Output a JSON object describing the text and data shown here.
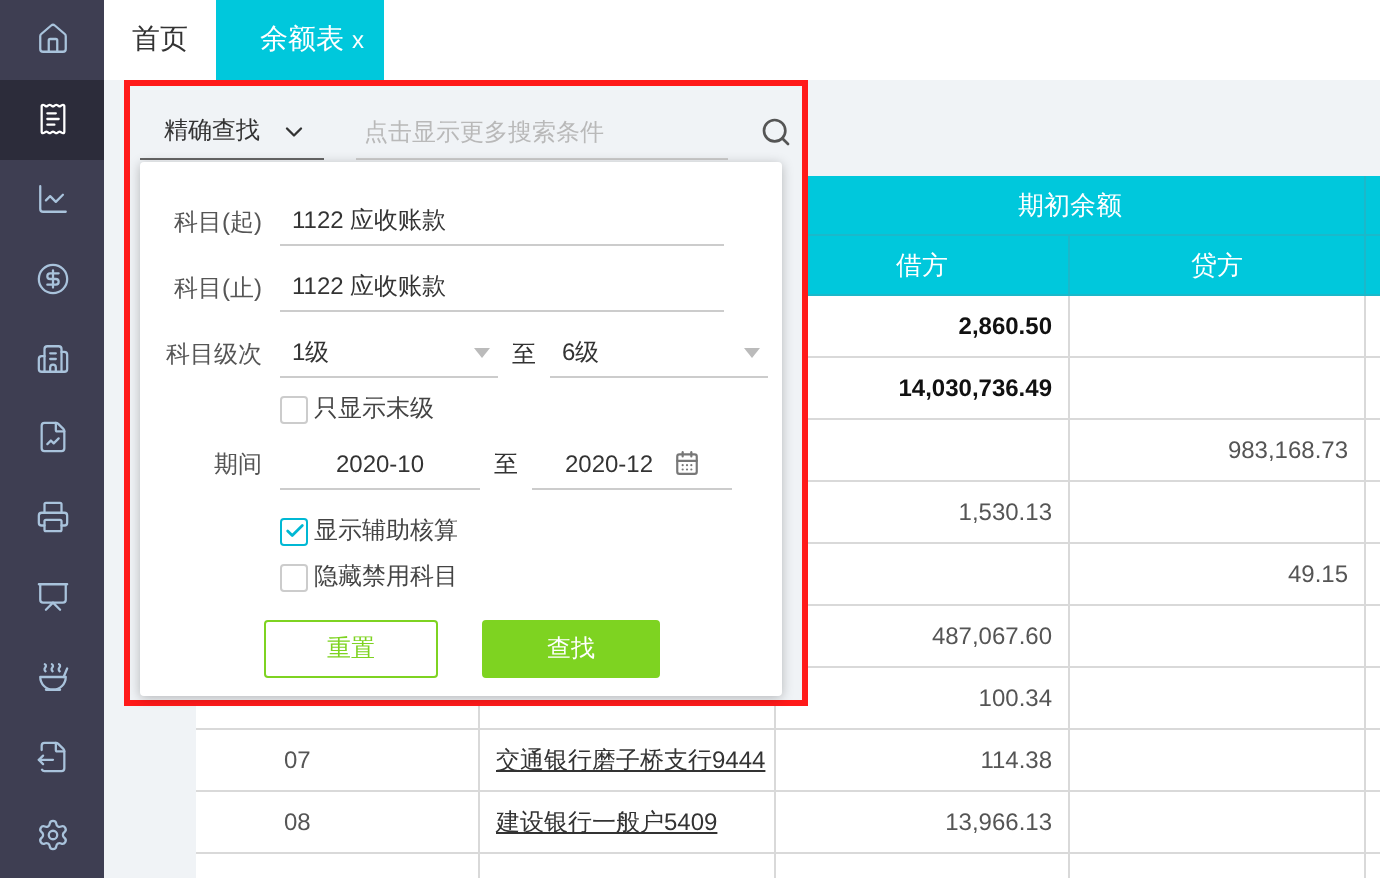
{
  "sidebar": {
    "items": [
      {
        "selected": false
      },
      {
        "selected": true
      },
      {
        "selected": false
      },
      {
        "selected": false
      },
      {
        "selected": false
      },
      {
        "selected": false
      },
      {
        "selected": false
      },
      {
        "selected": false
      },
      {
        "selected": false
      },
      {
        "selected": false
      },
      {
        "selected": false
      }
    ]
  },
  "tabs": [
    {
      "label": "首页",
      "selected": false
    },
    {
      "label": "余额表",
      "selected": true,
      "close": "x"
    }
  ],
  "search": {
    "mode": "精确查找",
    "placeholder": "点击显示更多搜索条件"
  },
  "filter_panel": {
    "account_from": {
      "label": "科目(起)",
      "value": "1122  应收账款"
    },
    "account_to": {
      "label": "科目(止)",
      "value": "1122  应收账款"
    },
    "level": {
      "label": "科目级次",
      "from": "1级",
      "to_label": "至",
      "to": "6级"
    },
    "leaf_only": {
      "label": "只显示末级",
      "checked": false
    },
    "period": {
      "label": "期间",
      "from": "2020-10",
      "to_label": "至",
      "to": "2020-12"
    },
    "show_auxiliary": {
      "label": "显示辅助核算",
      "checked": true
    },
    "hide_disabled": {
      "label": "隐藏禁用科目",
      "checked": false
    },
    "buttons": {
      "reset": "重置",
      "search": "查找"
    }
  },
  "table": {
    "group_header": "期初余额",
    "columns": [
      "借方",
      "贷方"
    ],
    "rows": [
      {
        "debit": "2,860.50",
        "bold": true
      },
      {
        "debit": "14,030,736.49",
        "bold": true
      },
      {
        "credit": "983,168.73",
        "bold": false
      },
      {
        "debit": "1,530.13",
        "bold": false
      },
      {
        "credit": "49.15",
        "bold": false
      },
      {
        "debit": "487,067.60",
        "bold": false
      },
      {
        "debit": "100.34",
        "bold": false
      },
      {
        "code": "07",
        "name": "交通银行磨子桥支行9444",
        "debit": "114.38",
        "bold": false
      },
      {
        "code": "08",
        "name": "建设银行一般户5409",
        "debit": "13,966.13",
        "bold": false
      },
      {}
    ]
  }
}
